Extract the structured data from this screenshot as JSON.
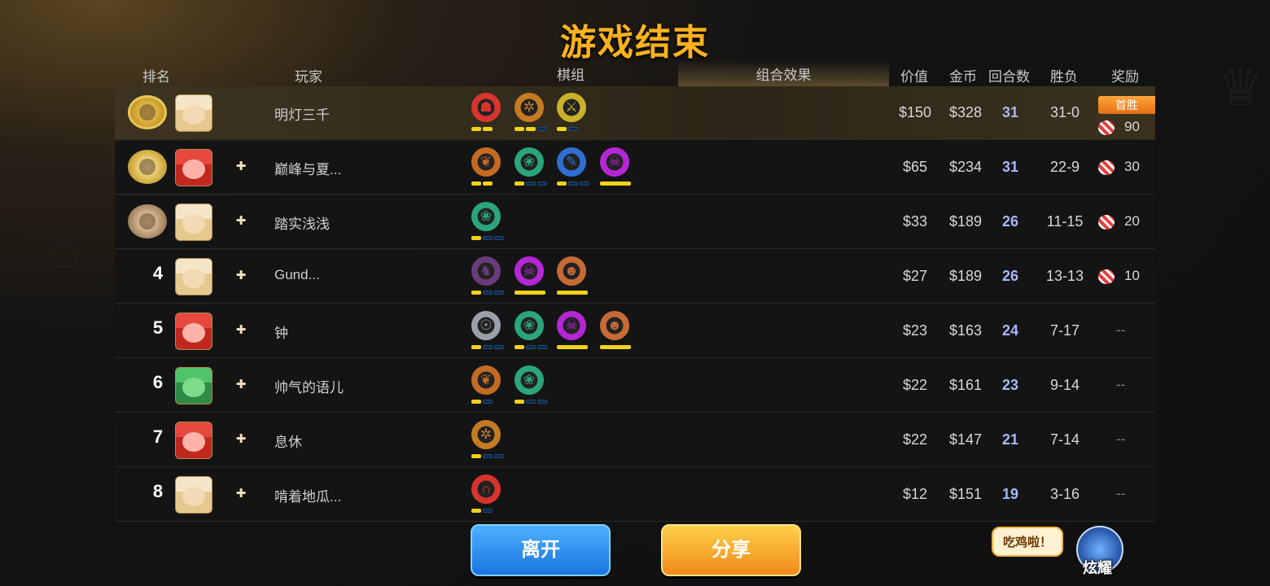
{
  "title": "游戏结束",
  "headers": {
    "rank": "排名",
    "player": "玩家",
    "board": "棋组",
    "effects": "组合效果",
    "value": "价值",
    "gold": "金币",
    "rounds": "回合数",
    "wl": "胜负",
    "reward": "奖励"
  },
  "players": [
    {
      "rank": "",
      "medal": "gold",
      "avatar": "blonde-girl",
      "friend": false,
      "name": "明灯三千",
      "value": "$150",
      "gold": "$328",
      "rounds": "31",
      "wl": "31-0",
      "reward": "90",
      "badge": "首胜",
      "synergies": [
        {
          "icon": "demon",
          "color": "#d5352d",
          "bars": [
            1,
            1
          ]
        },
        {
          "icon": "gear",
          "color": "#c47b24",
          "bars": [
            1,
            1,
            0
          ]
        },
        {
          "icon": "blade",
          "color": "#c9b22a",
          "bars": [
            1,
            0
          ]
        }
      ]
    },
    {
      "rank": "",
      "medal": "silver",
      "avatar": "red-dragon",
      "friend": true,
      "name": "巅峰与夏...",
      "value": "$65",
      "gold": "$234",
      "rounds": "31",
      "wl": "22-9",
      "reward": "30",
      "synergies": [
        {
          "icon": "feather",
          "color": "#c36a23",
          "bars": [
            1,
            1
          ]
        },
        {
          "icon": "paw",
          "color": "#2ba57c",
          "bars": [
            1,
            0,
            0
          ]
        },
        {
          "icon": "quill",
          "color": "#2f6fd1",
          "bars": [
            1,
            0,
            0
          ]
        },
        {
          "icon": "skull",
          "color": "#b527d4",
          "bars": [
            "full"
          ]
        }
      ]
    },
    {
      "rank": "",
      "medal": "bronze",
      "avatar": "blonde-girl",
      "friend": true,
      "name": "踏实浅浅",
      "value": "$33",
      "gold": "$189",
      "rounds": "26",
      "wl": "11-15",
      "reward": "20",
      "synergies": [
        {
          "icon": "paw",
          "color": "#2ba57c",
          "bars": [
            1,
            0,
            0
          ]
        }
      ]
    },
    {
      "rank": "4",
      "medal": "",
      "avatar": "blonde-girl",
      "friend": true,
      "name": "Gund...",
      "value": "$27",
      "gold": "$189",
      "rounds": "26",
      "wl": "13-13",
      "reward": "10",
      "synergies": [
        {
          "icon": "knight",
          "color": "#6a3b7a",
          "bars": [
            1,
            0,
            0
          ]
        },
        {
          "icon": "skull",
          "color": "#b527d4",
          "bars": [
            "full"
          ]
        },
        {
          "icon": "viking",
          "color": "#c76a35",
          "bars": [
            "full"
          ]
        }
      ]
    },
    {
      "rank": "5",
      "medal": "",
      "avatar": "red-dragon",
      "friend": true,
      "name": "钟",
      "value": "$23",
      "gold": "$163",
      "rounds": "24",
      "wl": "7-17",
      "reward": "--",
      "synergies": [
        {
          "icon": "helmet",
          "color": "#9aa0a8",
          "bars": [
            1,
            0,
            0
          ]
        },
        {
          "icon": "paw",
          "color": "#2ba57c",
          "bars": [
            1,
            0,
            0
          ]
        },
        {
          "icon": "skull",
          "color": "#b527d4",
          "bars": [
            "full"
          ]
        },
        {
          "icon": "viking",
          "color": "#c76a35",
          "bars": [
            "full"
          ]
        }
      ]
    },
    {
      "rank": "6",
      "medal": "",
      "avatar": "green-ogre",
      "friend": true,
      "name": "帅气的语儿",
      "value": "$22",
      "gold": "$161",
      "rounds": "23",
      "wl": "9-14",
      "reward": "--",
      "synergies": [
        {
          "icon": "feather",
          "color": "#c36a23",
          "bars": [
            1,
            0
          ]
        },
        {
          "icon": "paw",
          "color": "#2ba57c",
          "bars": [
            1,
            0,
            0
          ]
        }
      ]
    },
    {
      "rank": "7",
      "medal": "",
      "avatar": "red-dragon",
      "friend": true,
      "name": "息休",
      "value": "$22",
      "gold": "$147",
      "rounds": "21",
      "wl": "7-14",
      "reward": "--",
      "synergies": [
        {
          "icon": "gear",
          "color": "#c47b24",
          "bars": [
            1,
            0,
            0
          ]
        }
      ]
    },
    {
      "rank": "8",
      "medal": "",
      "avatar": "blonde-girl",
      "friend": true,
      "name": "啃着地瓜...",
      "value": "$12",
      "gold": "$151",
      "rounds": "19",
      "wl": "3-16",
      "reward": "--",
      "synergies": [
        {
          "icon": "arc",
          "color": "#d5352d",
          "bars": [
            1,
            0
          ]
        }
      ]
    }
  ],
  "buttons": {
    "leave": "离开",
    "share": "分享"
  },
  "show_off": {
    "bubble": "吃鸡啦！",
    "label": "炫耀"
  }
}
